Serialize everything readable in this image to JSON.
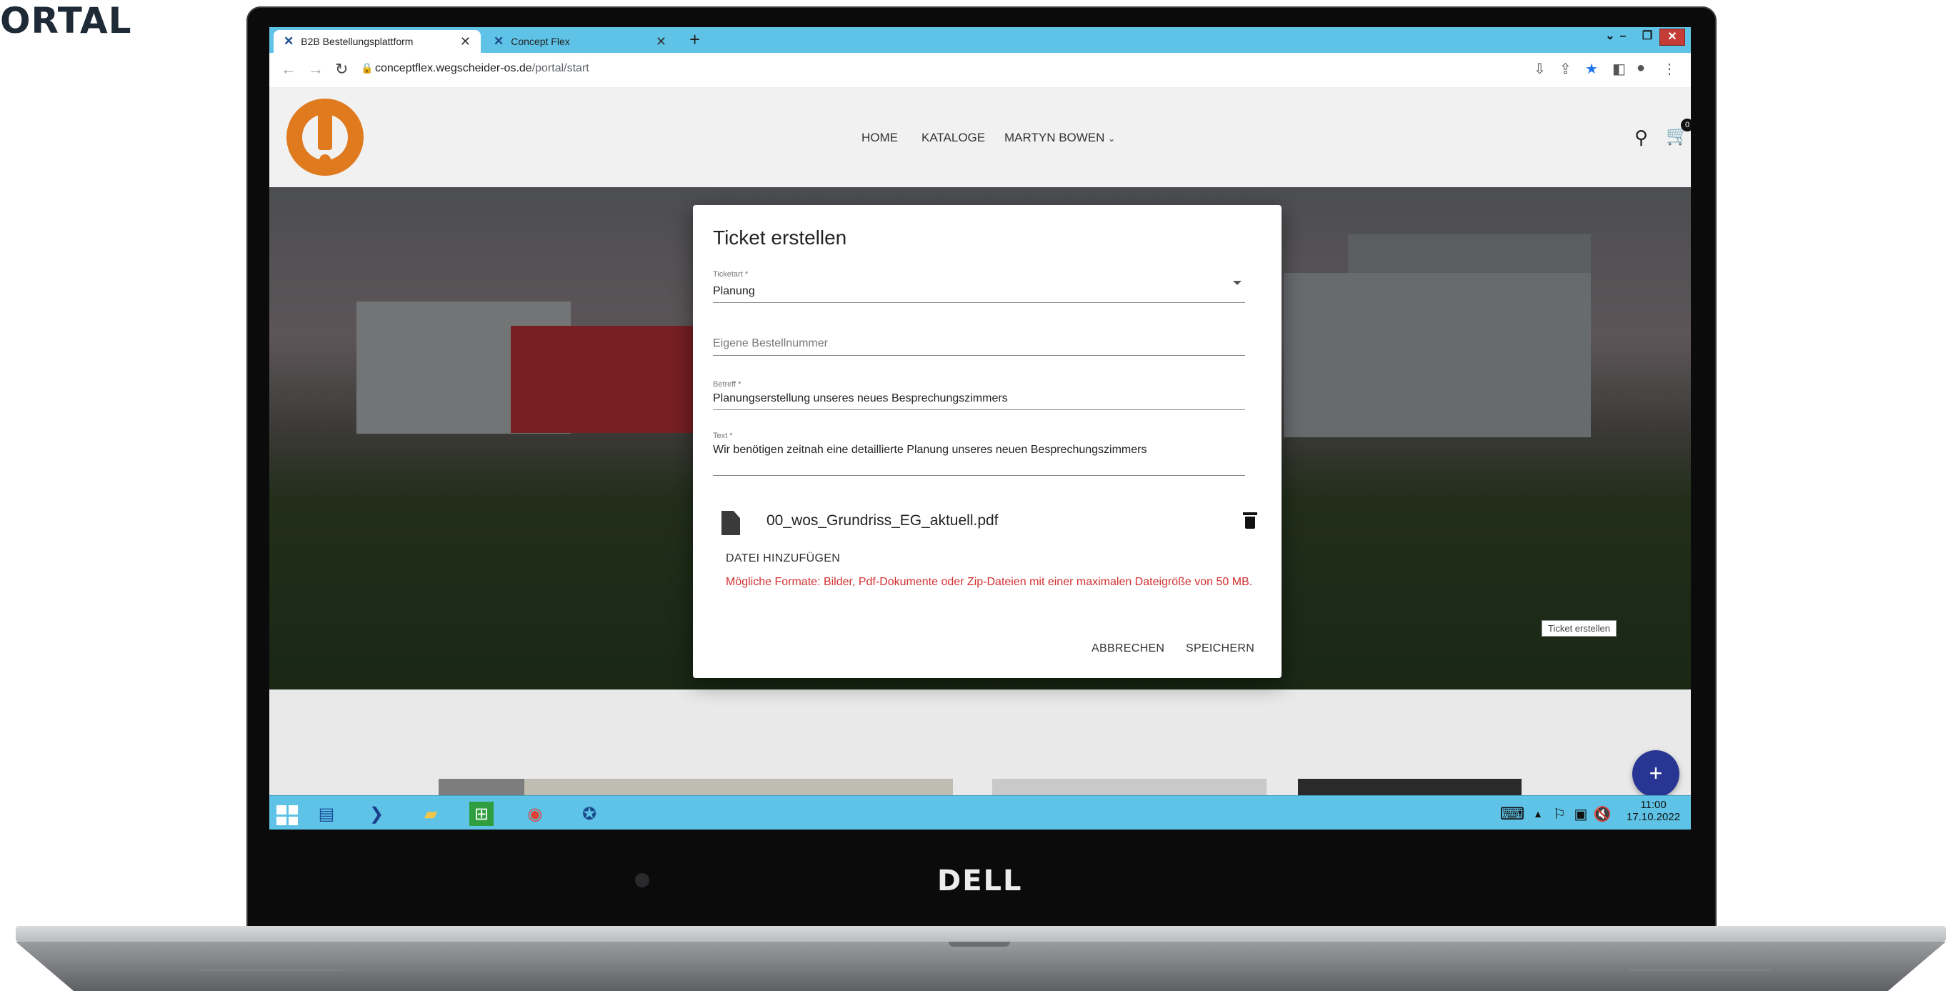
{
  "page": {
    "heading": "ORTAL"
  },
  "laptop": {
    "brand": "DELL"
  },
  "browser": {
    "tabs": [
      {
        "label": "B2B Bestellungsplattform",
        "active": true
      },
      {
        "label": "Concept Flex",
        "active": false
      }
    ],
    "new_tab": "+",
    "url_host": "conceptflex.wegscheider-os.de",
    "url_path": "/portal/start"
  },
  "site": {
    "nav": {
      "home": "HOME",
      "kataloge": "KATALOGE",
      "user": "MARTYN BOWEN"
    },
    "cart_count": "0",
    "fab": "+"
  },
  "modal": {
    "title": "Ticket erstellen",
    "ticketart": {
      "label": "Ticketart *",
      "value": "Planung"
    },
    "bestellnummer": {
      "placeholder": "Eigene Bestellnummer"
    },
    "betreff": {
      "label": "Betreff *",
      "value": "Planungserstellung unseres neues Besprechungszimmers"
    },
    "text": {
      "label": "Text *",
      "value": "Wir benötigen zeitnah eine detaillierte Planung unseres neuen Besprechungszimmers"
    },
    "attachment": {
      "filename": "00_wos_Grundriss_EG_aktuell.pdf"
    },
    "add_file": "DATEI HINZUFÜGEN",
    "hint": "Mögliche Formate: Bilder, Pdf-Dokumente oder Zip-Dateien mit einer maximalen Dateigröße von 50 MB.",
    "cancel": "ABBRECHEN",
    "save": "SPEICHERN"
  },
  "tooltip": "Ticket erstellen",
  "taskbar": {
    "time": "11:00",
    "date": "17.10.2022"
  },
  "colors": {
    "accent": "#283593",
    "error": "#d32f2f",
    "taskbar": "#5ec3e6",
    "brand_orange": "#e07a1f"
  }
}
